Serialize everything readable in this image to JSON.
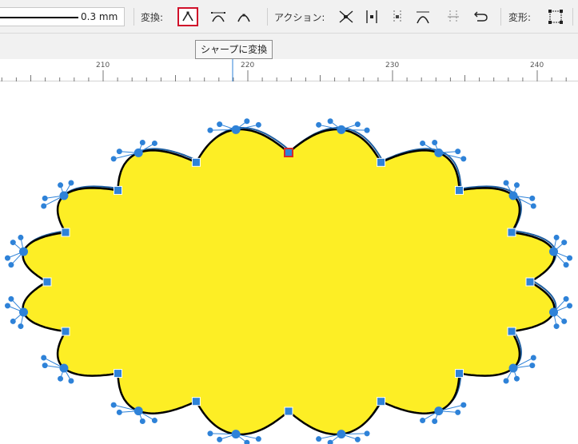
{
  "toolbar": {
    "stroke_width": "0.3 mm",
    "convert_label": "変換:",
    "action_label": "アクション:",
    "transform_label": "変形:",
    "convert_buttons": [
      {
        "name": "convert-to-sharp-icon",
        "active": true
      },
      {
        "name": "convert-to-smooth-icon",
        "active": false
      },
      {
        "name": "convert-to-smart-icon",
        "active": false
      }
    ],
    "action_buttons": [
      "break-curve-icon",
      "join-curves-icon",
      "split-curve-icon",
      "close-curve-icon",
      "smooth-curve-icon",
      "reverse-curve-icon"
    ],
    "transform_buttons": [
      "transform-box-icon"
    ]
  },
  "tooltip": "シャープに変換",
  "ruler": {
    "labels": [
      "210",
      "220",
      "230",
      "240"
    ],
    "marker_value": "219.3"
  },
  "shape": {
    "fill": "#fdee25",
    "stroke": "#000000",
    "selection_color": "#2e82d8",
    "selected_node_color": "#d42a2a",
    "lobe_count": 16
  }
}
